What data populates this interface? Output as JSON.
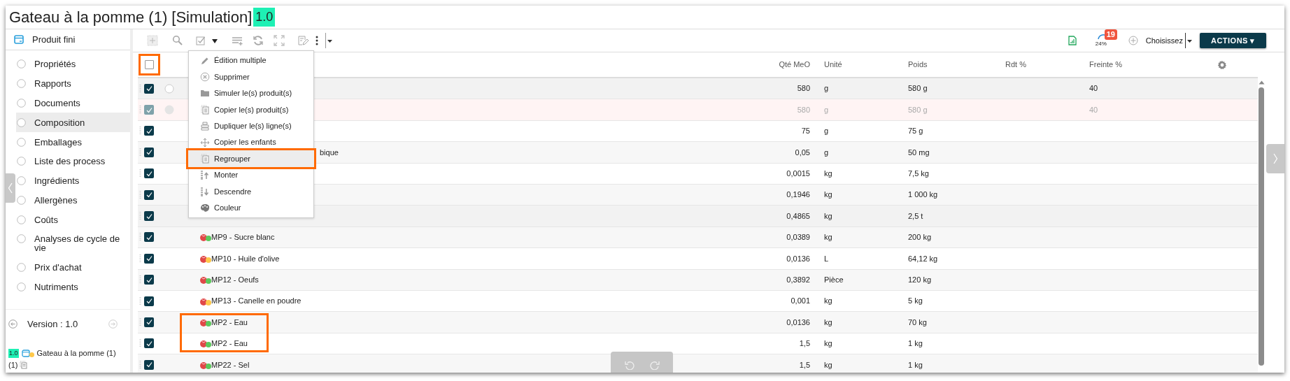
{
  "window": {
    "title": "Gateau à la pomme (1) [Simulation]",
    "version_badge": "1.0"
  },
  "sidebar": {
    "header": "Produit fini",
    "items": [
      {
        "label": "Propriétés",
        "selected": false
      },
      {
        "label": "Rapports",
        "selected": false
      },
      {
        "label": "Documents",
        "selected": false
      },
      {
        "label": "Composition",
        "selected": true
      },
      {
        "label": "Emballages",
        "selected": false
      },
      {
        "label": "Liste des process",
        "selected": false
      },
      {
        "label": "Ingrédients",
        "selected": false
      },
      {
        "label": "Allergènes",
        "selected": false
      },
      {
        "label": "Coûts",
        "selected": false
      },
      {
        "label": "Analyses de cycle de vie",
        "selected": false
      },
      {
        "label": "Prix d'achat",
        "selected": false
      },
      {
        "label": "Nutriments",
        "selected": false
      }
    ],
    "version": "Version : 1.0",
    "tree_item": {
      "badge": "1.0",
      "label": "Gateau à la pomme (1)",
      "suffix": "(1)",
      "color": "#ffc84a"
    }
  },
  "toolbar": {
    "progress": "24%",
    "badge": "19",
    "mode": "Choisissez",
    "actions_button": "ACTIONS ▾"
  },
  "menu": {
    "items": [
      {
        "label": "Édition multiple",
        "kind": "pencil",
        "highlighted": false
      },
      {
        "label": "Supprimer",
        "kind": "delete",
        "highlighted": false
      },
      {
        "label": "Simuler le(s) produit(s)",
        "kind": "folder",
        "highlighted": false
      },
      {
        "label": "Copier le(s) produit(s)",
        "kind": "copy",
        "highlighted": false
      },
      {
        "label": "Dupliquer le(s) ligne(s)",
        "kind": "stack",
        "highlighted": false
      },
      {
        "label": "Copier les enfants",
        "kind": "move",
        "highlighted": false
      },
      {
        "label": "Regrouper",
        "kind": "copy",
        "highlighted": true
      },
      {
        "label": "Monter",
        "kind": "up",
        "highlighted": false
      },
      {
        "label": "Descendre",
        "kind": "down",
        "highlighted": false
      },
      {
        "label": "Couleur",
        "kind": "palette",
        "highlighted": false
      }
    ]
  },
  "table": {
    "columns": [
      "Qté MeO",
      "Unité",
      "Poids",
      "Rdt %",
      "Freinte %"
    ],
    "header_checkbox": {
      "checked": false,
      "highlighted": true
    },
    "rows": [
      {
        "checked": true,
        "disabled": false,
        "kind": "circle",
        "qty": "580",
        "unit": "g",
        "weight": "580 g",
        "loss": "40",
        "highlighted": false
      },
      {
        "checked": true,
        "disabled": true,
        "kind": "circle",
        "qty": "580",
        "unit": "g",
        "weight": "580 g",
        "loss": "40",
        "highlighted": false
      },
      {
        "checked": true,
        "disabled": false,
        "qty": "75",
        "unit": "g",
        "weight": "75 g",
        "highlighted": false
      },
      {
        "checked": true,
        "disabled": false,
        "name": "bique",
        "name_clipped": true,
        "qty": "0,05",
        "unit": "g",
        "weight": "50 mg",
        "highlighted": false
      },
      {
        "checked": true,
        "disabled": false,
        "qty": "0,0015",
        "unit": "kg",
        "weight": "7,5 kg",
        "highlighted": false
      },
      {
        "checked": true,
        "disabled": false,
        "qty": "0,1946",
        "unit": "kg",
        "weight": "1 000 kg",
        "highlighted": false
      },
      {
        "checked": true,
        "disabled": false,
        "qty": "0,4865",
        "unit": "kg",
        "weight": "2,5 t",
        "highlighted": false
      },
      {
        "checked": true,
        "disabled": false,
        "kind": "ingredient",
        "color": "#5cc85c",
        "name": "MP9 - Sucre blanc",
        "qty": "0,0389",
        "unit": "kg",
        "weight": "200 kg",
        "highlighted": false
      },
      {
        "checked": true,
        "disabled": false,
        "kind": "ingredient",
        "color": "#ffc84a",
        "name": "MP10 - Huile d'olive",
        "qty": "0,0136",
        "unit": "L",
        "weight": "64,12 kg",
        "highlighted": false
      },
      {
        "checked": true,
        "disabled": false,
        "kind": "ingredient",
        "color": "#5cc85c",
        "name": "MP12 - Oeufs",
        "qty": "0,3892",
        "unit": "Pièce",
        "weight": "120 kg",
        "highlighted": false
      },
      {
        "checked": true,
        "disabled": false,
        "kind": "ingredient",
        "color": "#ffc84a",
        "name": "MP13 - Canelle en poudre",
        "qty": "0,001",
        "unit": "kg",
        "weight": "5 kg",
        "highlighted": false
      },
      {
        "checked": true,
        "disabled": false,
        "kind": "ingredient",
        "color": "#5cc85c",
        "name": "MP2 - Eau",
        "qty": "0,0136",
        "unit": "kg",
        "weight": "70 kg",
        "highlighted": true
      },
      {
        "checked": true,
        "disabled": false,
        "kind": "ingredient",
        "color": "#5cc85c",
        "name": "MP2 - Eau",
        "qty": "1,5",
        "unit": "kg",
        "weight": "1 kg",
        "highlighted": true
      },
      {
        "checked": true,
        "disabled": false,
        "kind": "ingredient",
        "color": "#5cc85c",
        "name": "MP22 - Sel",
        "qty": "1,5",
        "unit": "kg",
        "weight": "1 kg",
        "highlighted": false
      }
    ]
  }
}
